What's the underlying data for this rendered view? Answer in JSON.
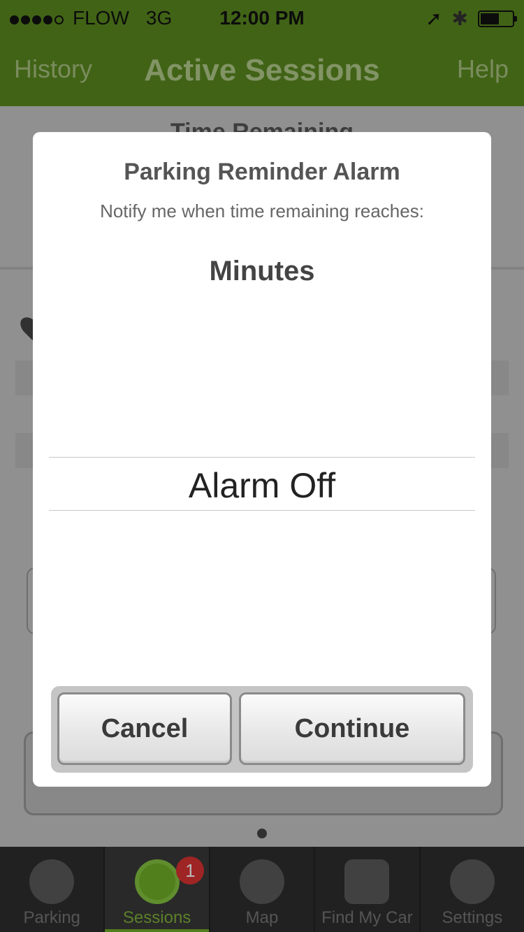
{
  "status_bar": {
    "carrier": "FLOW",
    "network": "3G",
    "time": "12:00 PM",
    "icons": [
      "location-arrow-icon",
      "bluetooth-icon",
      "battery-icon"
    ]
  },
  "nav_bar": {
    "left": "History",
    "title": "Active Sessions",
    "right": "Help"
  },
  "background": {
    "section_title": "Time Remaining"
  },
  "dialog": {
    "title": "Parking Reminder Alarm",
    "subtitle": "Notify me when time remaining reaches:",
    "picker_header": "Minutes",
    "selected_value": "Alarm Off",
    "cancel_label": "Cancel",
    "continue_label": "Continue"
  },
  "tabs": [
    {
      "label": "Parking",
      "icon": "parking-meter-icon"
    },
    {
      "label": "Sessions",
      "icon": "sessions-clock-icon",
      "badge": "1",
      "active": true
    },
    {
      "label": "Map",
      "icon": "globe-icon"
    },
    {
      "label": "Find My Car",
      "icon": "car-icon"
    },
    {
      "label": "Settings",
      "icon": "gear-icon"
    }
  ],
  "colors": {
    "header_green": "#5a8a1f",
    "active_tab_green": "#6fb028",
    "badge_red": "#dd3333"
  }
}
